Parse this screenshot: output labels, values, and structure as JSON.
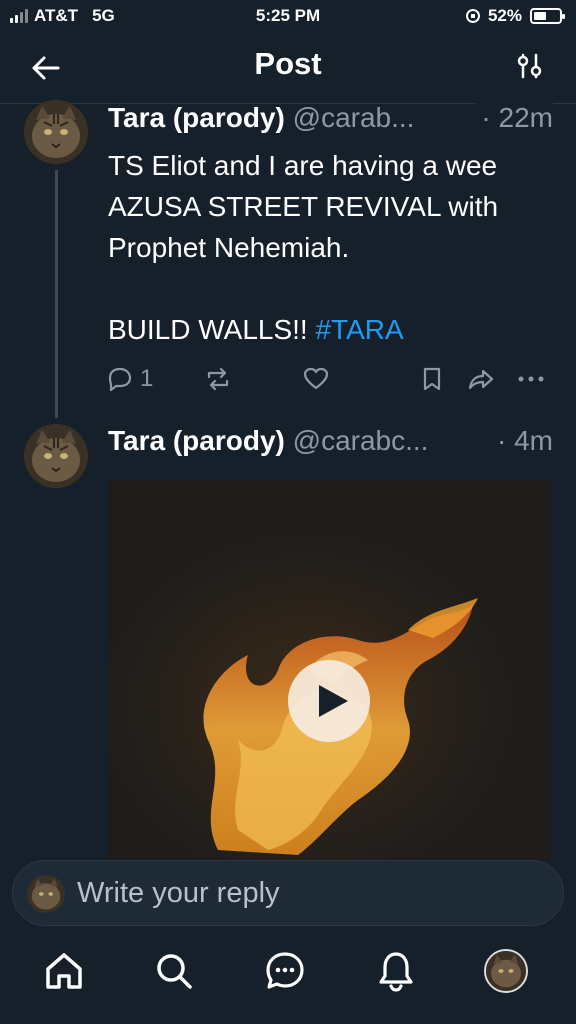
{
  "status_bar": {
    "carrier": "AT&T",
    "network": "5G",
    "time": "5:25 PM",
    "battery": "52%",
    "battery_level": 0.52
  },
  "header": {
    "title": "Post",
    "back_icon": "arrow-left-icon",
    "settings_icon": "sliders-icon"
  },
  "posts": [
    {
      "name": "Tara (parody)",
      "handle": "@carab...",
      "time": "· 22m",
      "text_line1": "TS Eliot and I are having a wee",
      "text_line2": "AZUSA STREET REVIVAL with",
      "text_line3": "Prophet Nehemiah.",
      "text_line4": "BUILD WALLS!!",
      "hashtag": "#TARA",
      "reply_count": "1",
      "action_icons": [
        "reply-icon",
        "retweet-icon",
        "like-icon",
        "bookmark-icon",
        "share-icon",
        "more-icon"
      ]
    },
    {
      "name": "Tara (parody)",
      "handle": "@carabc...",
      "time": "· 4m",
      "media": "video"
    }
  ],
  "reply_bar": {
    "placeholder": "Write your reply"
  },
  "bottom_nav": {
    "items": [
      "home-icon",
      "search-icon",
      "messages-icon",
      "notifications-icon",
      "profile-avatar"
    ]
  },
  "colors": {
    "background": "#15202b",
    "accent": "#1d9bf0",
    "muted": "#8b98a5"
  }
}
